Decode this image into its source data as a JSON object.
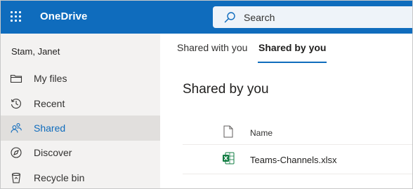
{
  "app": {
    "name": "OneDrive",
    "brand_color": "#0f6cbd"
  },
  "search": {
    "placeholder": "Search",
    "icon": "search-icon"
  },
  "sidebar": {
    "user": "Stam, Janet",
    "items": [
      {
        "label": "My files",
        "icon": "folder-icon",
        "active": false
      },
      {
        "label": "Recent",
        "icon": "history-icon",
        "active": false
      },
      {
        "label": "Shared",
        "icon": "people-icon",
        "active": true
      },
      {
        "label": "Discover",
        "icon": "compass-icon",
        "active": false
      },
      {
        "label": "Recycle bin",
        "icon": "recycle-bin-icon",
        "active": false
      }
    ]
  },
  "tabs": [
    {
      "label": "Shared with you",
      "active": false
    },
    {
      "label": "Shared by you",
      "active": true
    }
  ],
  "main": {
    "title": "Shared by you",
    "columns": {
      "file_type_icon": "document-icon",
      "name": "Name"
    },
    "files": [
      {
        "name": "Teams-Channels.xlsx",
        "icon": "excel-file-icon"
      }
    ]
  }
}
